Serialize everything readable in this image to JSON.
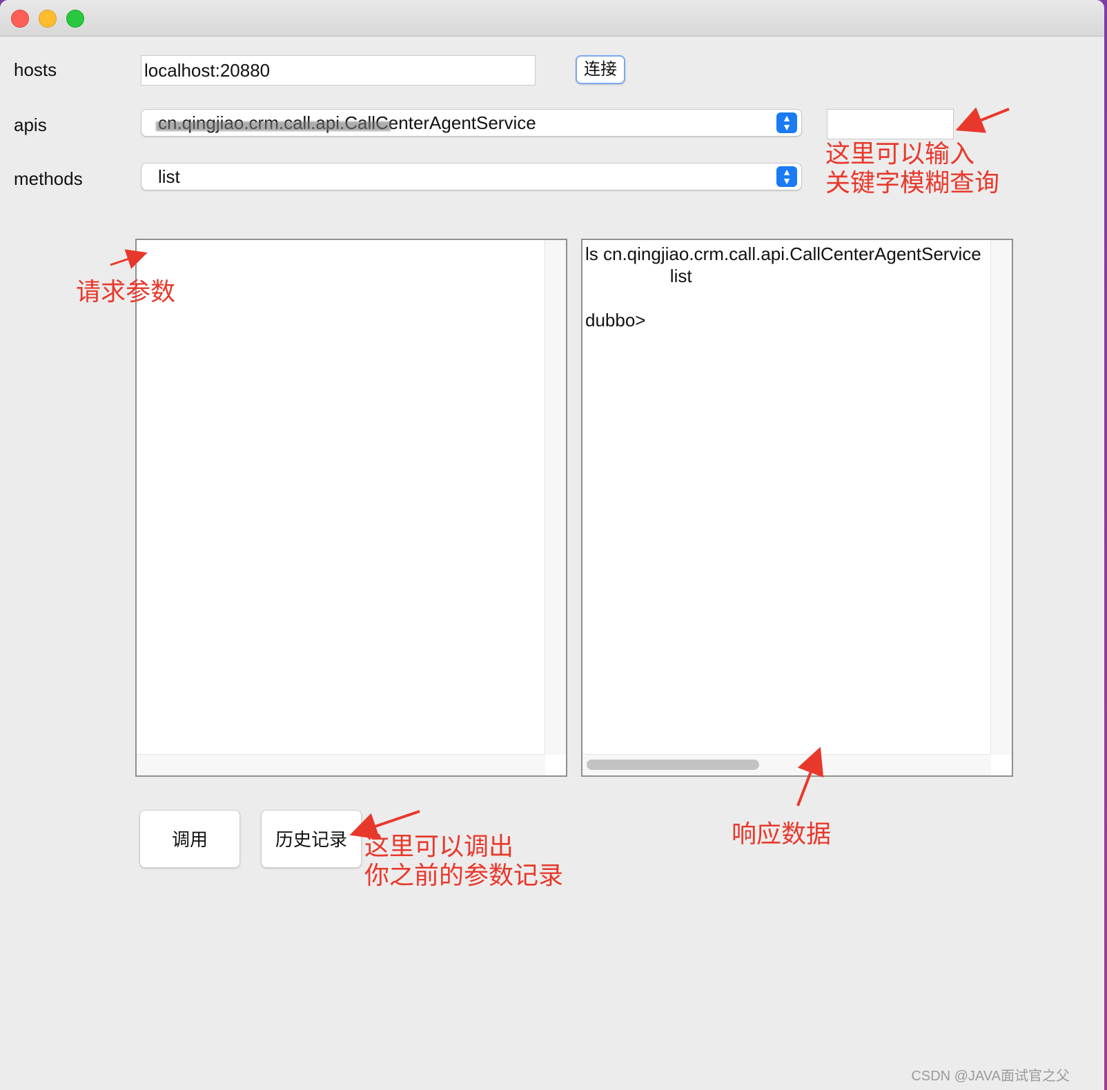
{
  "form": {
    "hosts_label": "hosts",
    "hosts_value": "localhost:20880",
    "connect_button": "连接",
    "apis_label": "apis",
    "apis_selected": "cn.qingjiao.crm.call.api.CallCenterAgentService",
    "apis_search_value": "",
    "methods_label": "methods",
    "methods_selected": "list"
  },
  "response": {
    "text": "ls cn.qingjiao.crm.call.api.CallCenterAgentService\n                 list\n\ndubbo>"
  },
  "buttons": {
    "invoke": "调用",
    "history": "历史记录"
  },
  "annotations": {
    "search_hint": "这里可以输入\n关键字模糊查询",
    "request_params": "请求参数",
    "history_hint": "这里可以调出\n你之前的参数记录",
    "response_data": "响应数据"
  },
  "watermark": "CSDN @JAVA面试官之父",
  "colors": {
    "annotation": "#e8382b",
    "accent": "#1a7bf4"
  }
}
